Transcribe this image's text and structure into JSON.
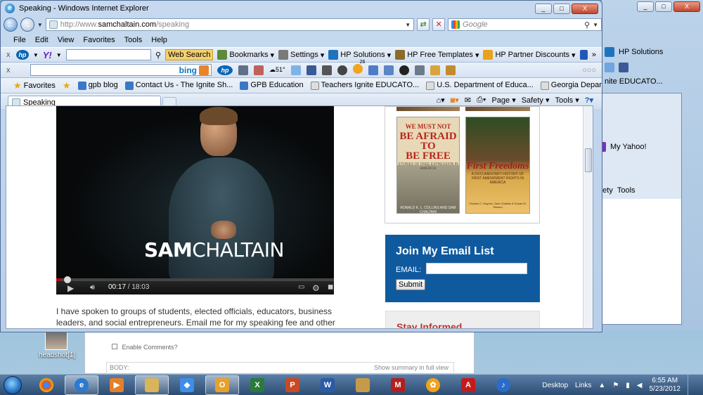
{
  "window": {
    "title": "Speaking - Windows Internet Explorer",
    "controls": {
      "minimize": "_",
      "maximize": "□",
      "close": "X"
    }
  },
  "address": {
    "url_prefix": "http://www.",
    "url_domain": "samchaltain.com",
    "url_path": "/speaking",
    "search_placeholder": "Google"
  },
  "menu": [
    "File",
    "Edit",
    "View",
    "Favorites",
    "Tools",
    "Help"
  ],
  "hp_toolbar": {
    "web_search": "Web Search",
    "bookmarks": "Bookmarks",
    "settings": "Settings",
    "hp_solutions": "HP Solutions",
    "hp_templates": "HP Free Templates",
    "hp_partner": "HP Partner Discounts",
    "temp": "51°",
    "badge": "26"
  },
  "bing": {
    "label": "bing"
  },
  "favorites": {
    "label": "Favorites",
    "items": [
      "gpb blog",
      "Contact Us - The Ignite Sh...",
      "GPB Education",
      "Teachers Ignite EDUCATO...",
      "U.S. Department of Educa...",
      "Georgia Department of Ed..."
    ]
  },
  "tab": {
    "label": "Speaking"
  },
  "commandbar": {
    "page": "Page",
    "safety": "Safety",
    "tools": "Tools"
  },
  "video": {
    "brand_bold": "SAM",
    "brand_light": "CHALTAIN",
    "current": "00:17",
    "total": "18:03",
    "progress": 0.016
  },
  "content": {
    "paragraph": "I have spoken to groups of students, elected officials, educators, business leaders, and social entrepreneurs. Email me for my speaking fee and other information via"
  },
  "books": [
    {
      "title_1": "WE MUST NOT",
      "title_2": "BE AFRAID TO",
      "title_3": "BE FREE",
      "subtitle": "STORIES OF FREE EXPRESSION IN AMERICA",
      "authors": "RONALD K. L. COLLINS AND SAM CHALTAIN"
    },
    {
      "title": "First Freedoms",
      "subtitle": "A DOCUMENTARY HISTORY OF FIRST AMENDMENT RIGHTS IN AMERICA",
      "authors": "Charles C. Haynes, Sam Chaltain & Susan M. Glisson"
    }
  ],
  "email_signup": {
    "heading": "Join My Email List",
    "label": "EMAIL:",
    "submit": "Submit"
  },
  "stay_informed": {
    "heading": "Stay Informed"
  },
  "background_window": {
    "hp_solutions": "HP Solutions",
    "fav_item": "nite EDUCATO...",
    "my_yahoo": "My Yahoo!",
    "safety": "afety",
    "tools": "Tools"
  },
  "editor": {
    "enable_comments": "Enable Comments?",
    "body_label": "BODY:",
    "show_summary": "Show summary in full view"
  },
  "desktop_icon": {
    "label": "headshot[1]"
  },
  "taskbar": {
    "desktop": "Desktop",
    "links": "Links",
    "time": "6:55 AM",
    "date": "5/23/2012"
  }
}
